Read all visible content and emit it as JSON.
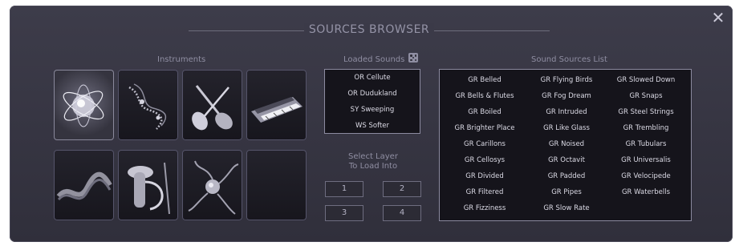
{
  "window": {
    "title": "SOURCES BROWSER",
    "close_icon": "close-icon"
  },
  "instruments": {
    "label": "Instruments",
    "tiles": [
      {
        "icon": "atom-orb-icon",
        "selected": true
      },
      {
        "icon": "abstract-spiral-icon",
        "selected": false
      },
      {
        "icon": "guitar-violin-icon",
        "selected": false
      },
      {
        "icon": "synth-keyboard-icon",
        "selected": false
      },
      {
        "icon": "wave-ribbon-icon",
        "selected": false
      },
      {
        "icon": "brass-horn-icon",
        "selected": false
      },
      {
        "icon": "creature-tentacles-icon",
        "selected": false
      },
      {
        "icon": "empty-slot",
        "selected": false
      }
    ]
  },
  "loaded": {
    "label": "Loaded Sounds",
    "dice_icon": "dice-icon",
    "items": [
      "OR Cellute",
      "OR Dudukland",
      "SY Sweeping",
      "WS Softer"
    ]
  },
  "layer": {
    "label_line1": "Select Layer",
    "label_line2": "To Load Into",
    "buttons": [
      "1",
      "2",
      "3",
      "4"
    ]
  },
  "sources": {
    "label": "Sound Sources List",
    "columns": [
      [
        "GR Belled",
        "GR Bells & Flutes",
        "GR Boiled",
        "GR Brighter Place",
        "GR Carillons",
        "GR Cellosys",
        "GR Divided",
        "GR Filtered",
        "GR Fizziness"
      ],
      [
        "GR Flying Birds",
        "GR Fog Dream",
        "GR Intruded",
        "GR Like Glass",
        "GR Noised",
        "GR Octavit",
        "GR Padded",
        "GR Pipes",
        "GR Slow Rate"
      ],
      [
        "GR Slowed Down",
        "GR Snaps",
        "GR Steel Strings",
        "GR Trembling",
        "GR Tubulars",
        "GR Universalis",
        "GR Velocipede",
        "GR Waterbells"
      ]
    ]
  }
}
